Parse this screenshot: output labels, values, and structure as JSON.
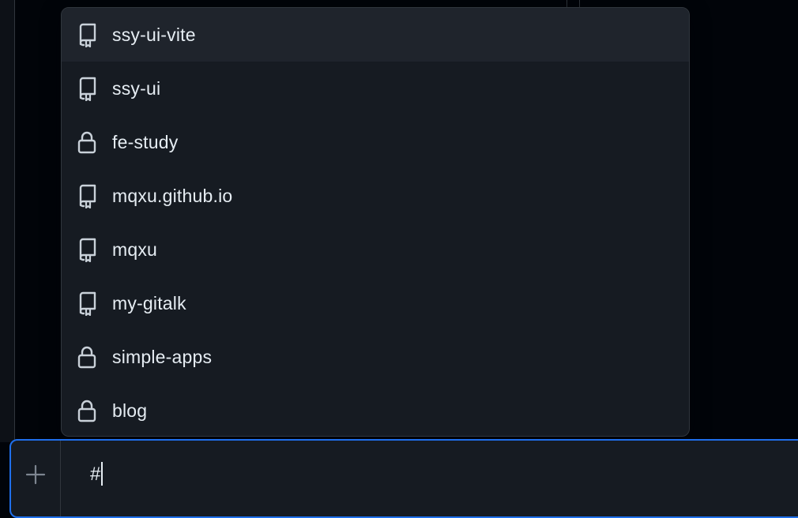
{
  "dropdown": {
    "items": [
      {
        "label": "ssy-ui-vite",
        "icon": "repo-icon",
        "active": true
      },
      {
        "label": "ssy-ui",
        "icon": "repo-icon",
        "active": false
      },
      {
        "label": "fe-study",
        "icon": "lock-icon",
        "active": false
      },
      {
        "label": "mqxu.github.io",
        "icon": "repo-icon",
        "active": false
      },
      {
        "label": "mqxu",
        "icon": "repo-icon",
        "active": false
      },
      {
        "label": "my-gitalk",
        "icon": "repo-icon",
        "active": false
      },
      {
        "label": "simple-apps",
        "icon": "lock-icon",
        "active": false
      },
      {
        "label": "blog",
        "icon": "lock-icon",
        "active": false
      }
    ]
  },
  "composer": {
    "value": "#",
    "add_icon": "plus-icon"
  },
  "colors": {
    "background": "#010409",
    "panel": "#161b22",
    "highlight": "#1f242c",
    "border": "#30363d",
    "focus_border": "#1f6feb",
    "text": "#e6edf3"
  }
}
